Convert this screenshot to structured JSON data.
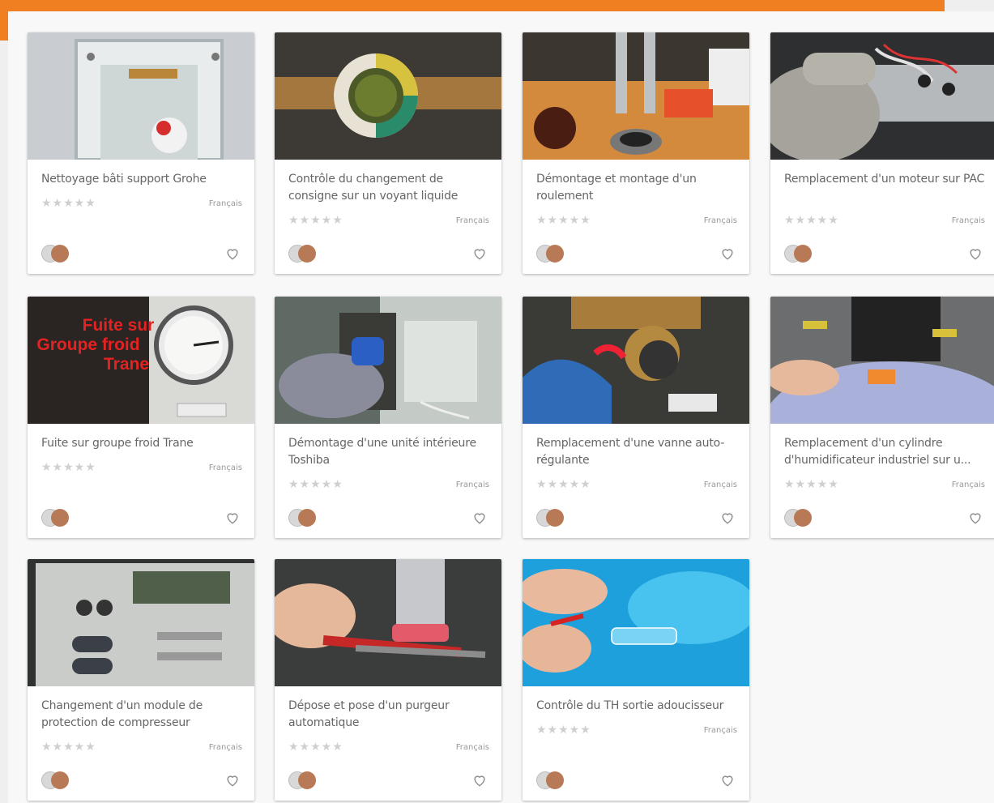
{
  "theme": {
    "accent": "#f07f22"
  },
  "cards": [
    {
      "title": "Nettoyage bâti support Grohe",
      "rating": "★★★★★",
      "language": "Français"
    },
    {
      "title": "Contrôle du changement de consigne sur un voyant liquide",
      "rating": "★★★★★",
      "language": "Français"
    },
    {
      "title": "Démontage et montage d'un roulement",
      "rating": "★★★★★",
      "language": "Français"
    },
    {
      "title": "Remplacement d'un moteur sur PAC",
      "rating": "★★★★★",
      "language": "Français"
    },
    {
      "title": "Fuite sur groupe froid Trane",
      "rating": "★★★★★",
      "language": "Français",
      "overlay": [
        "Fuite sur",
        "Groupe froid",
        "Trane"
      ]
    },
    {
      "title": "Démontage d'une unité intérieure Toshiba",
      "rating": "★★★★★",
      "language": "Français"
    },
    {
      "title": "Remplacement d'une vanne auto-régulante",
      "rating": "★★★★★",
      "language": "Français"
    },
    {
      "title": "Remplacement d'un cylindre d'humidificateur industriel sur u...",
      "rating": "★★★★★",
      "language": "Français"
    },
    {
      "title": "Changement d'un module de protection de compresseur",
      "rating": "★★★★★",
      "language": "Français"
    },
    {
      "title": "Dépose et pose d'un purgeur automatique",
      "rating": "★★★★★",
      "language": "Français"
    },
    {
      "title": "Contrôle du TH sortie adoucisseur",
      "rating": "★★★★★",
      "language": "Français"
    }
  ]
}
